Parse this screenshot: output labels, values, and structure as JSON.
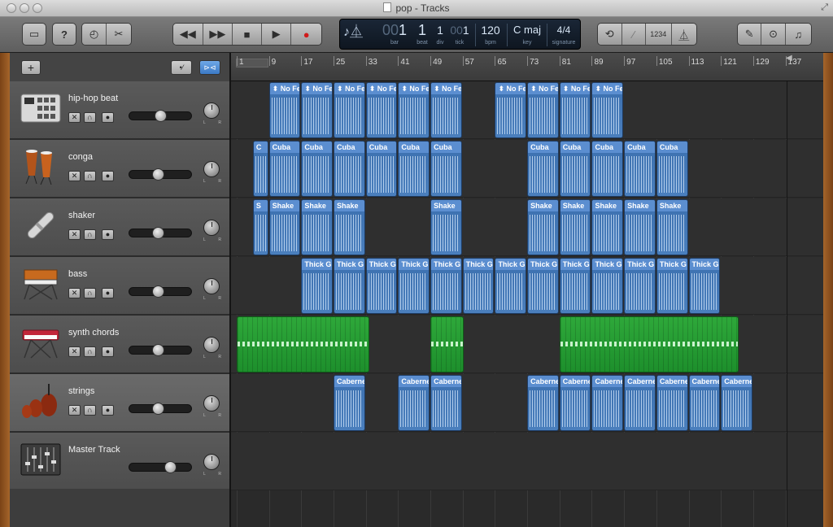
{
  "window": {
    "title": "pop - Tracks",
    "fullscreen_icon": "fullscreen-icon"
  },
  "toolbar": {
    "left_buttons": [
      "library-icon",
      "help-icon",
      "smart-controls-icon",
      "editors-icon"
    ],
    "transport": [
      "rewind-icon",
      "fast-forward-icon",
      "stop-icon",
      "play-icon",
      "record-icon"
    ],
    "right_buttons": [
      "cycle-icon",
      "tuner-icon",
      "count-in-icon",
      "metronome-icon"
    ],
    "far_right_buttons": [
      "notepad-icon",
      "loop-browser-icon",
      "media-browser-icon"
    ],
    "count_in_label": "1234"
  },
  "lcd": {
    "bar": "1",
    "bar_prefix": "00",
    "bar_label": "bar",
    "beat": "1",
    "beat_label": "beat",
    "div": "1",
    "div_label": "div",
    "tick": "1",
    "tick_prefix": "00",
    "tick_label": "tick",
    "bpm": "120",
    "bpm_label": "bpm",
    "key": "C maj",
    "key_label": "key",
    "signature": "4/4",
    "signature_label": "signature",
    "colors": {
      "bg": "#0e1620",
      "text": "#d8e6f5"
    }
  },
  "tracks_header": {
    "add_label": "+"
  },
  "tracks": [
    {
      "name": "hip-hop beat",
      "icon": "drum-machine-icon",
      "volume": 0.5
    },
    {
      "name": "conga",
      "icon": "conga-icon",
      "volume": 0.45
    },
    {
      "name": "shaker",
      "icon": "shaker-icon",
      "volume": 0.45
    },
    {
      "name": "bass",
      "icon": "synth-bass-icon",
      "volume": 0.45
    },
    {
      "name": "synth chords",
      "icon": "keyboard-icon",
      "volume": 0.45
    },
    {
      "name": "strings",
      "icon": "strings-icon",
      "volume": 0.45
    },
    {
      "name": "Master Track",
      "icon": "mixer-icon",
      "volume": 0.7
    }
  ],
  "ruler": {
    "marks": [
      "1",
      "9",
      "17",
      "25",
      "33",
      "41",
      "49",
      "57",
      "65",
      "73",
      "81",
      "89",
      "97",
      "105",
      "113",
      "121",
      "129",
      "137"
    ]
  },
  "region_names": {
    "hiphop": "No Fe",
    "conga_a": "C",
    "conga": "Cuba",
    "shaker_a": "S",
    "shaker": "Shake",
    "bass": "Thick G",
    "strings": "Caberne"
  },
  "colors": {
    "audio_region": "#4a7fbd",
    "midi_region": "#2ea83a",
    "lane_bg": "#2f2f2f"
  }
}
